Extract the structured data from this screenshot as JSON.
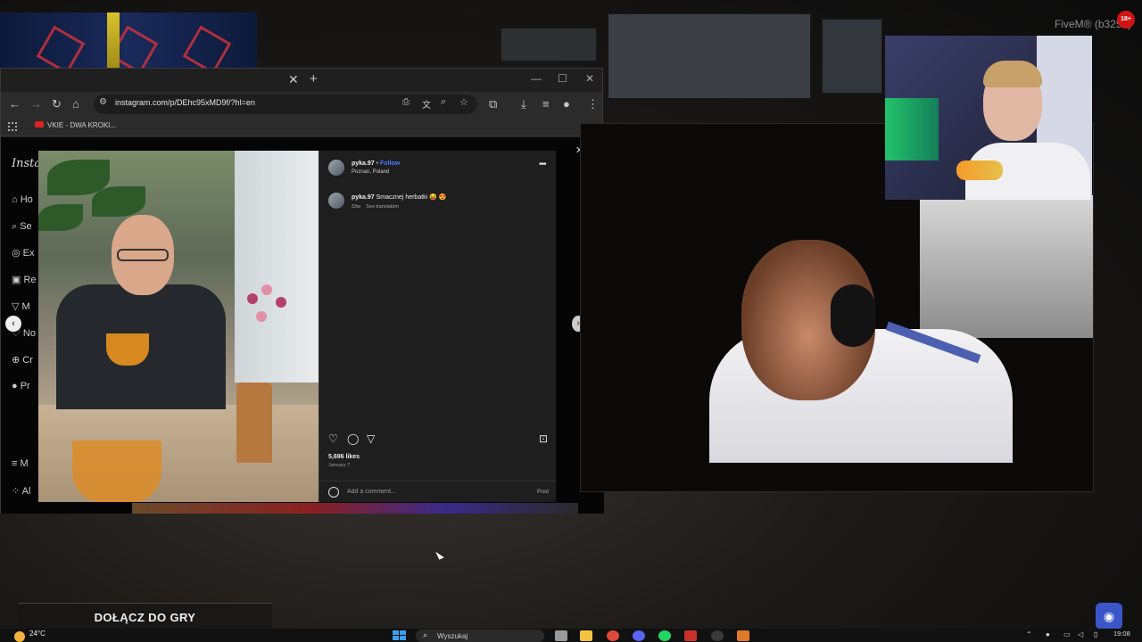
{
  "stream": {
    "title": "FiveM® (b3258)",
    "rec_badge": "18+"
  },
  "browser": {
    "url": "instagram.com/p/DEhc95xMD9f/?hl=en",
    "bookmark": "VKIE - DWA KROKI..."
  },
  "instagram": {
    "logo": "Insta",
    "sidebar": [
      "Ho",
      "Se",
      "Ex",
      "Re",
      "M",
      "No",
      "Cr",
      "Pr",
      "M",
      "Al"
    ],
    "post": {
      "username": "pyka.97",
      "follow": "Follow",
      "location": "Poznan, Poland",
      "caption_user": "pyka.97",
      "caption_text": "Smacznej herbatki 😝 😍",
      "caption_age": "33w",
      "see_translation": "See translation",
      "likes": "5,696 likes",
      "date": "January 7",
      "comment_placeholder": "Add a comment...",
      "post_label": "Post"
    }
  },
  "overlay": {
    "join_label": "DOŁĄCZ DO GRY"
  },
  "taskbar": {
    "temperature": "24°C",
    "search_label": "Wyszukaj",
    "time": "19:08"
  }
}
